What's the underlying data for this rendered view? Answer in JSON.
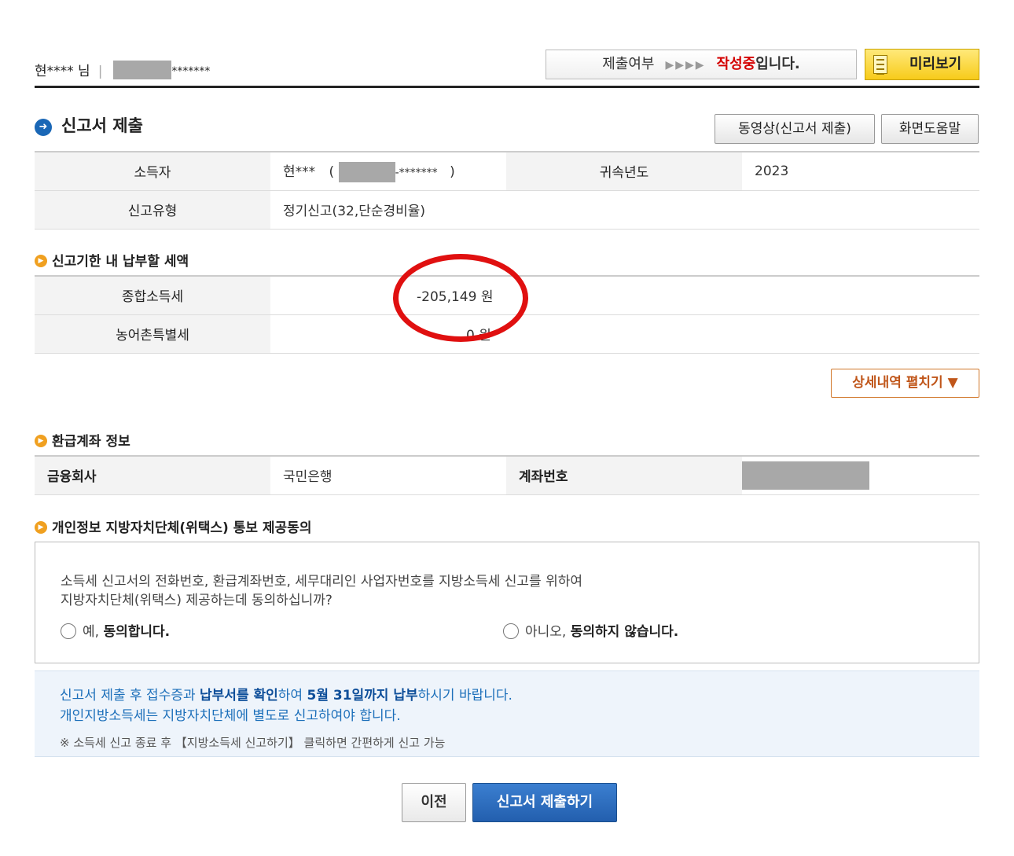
{
  "header": {
    "user_name": "현**** 님",
    "separator": "|",
    "user_id_suffix": "*******",
    "status_label": "제출여부",
    "status_arrows": "▶▶▶▶",
    "status_value": "작성중",
    "status_suffix": "입니다.",
    "preview_label": "미리보기",
    "preview_icon": "document-icon"
  },
  "section_title": "신고서 제출",
  "buttons": {
    "video": "동영상(신고서 제출)",
    "help": "화면도움말",
    "detail": "상세내역 펼치기 ▼",
    "prev": "이전",
    "submit": "신고서 제출하기"
  },
  "info": {
    "taxpayer_label": "소득자",
    "taxpayer_name": "현***",
    "taxpayer_open": "(",
    "taxpayer_id_suffix": "-*******",
    "taxpayer_close": ")",
    "year_label": "귀속년도",
    "year_value": "2023",
    "type_label": "신고유형",
    "type_value": "정기신고(32,단순경비율)"
  },
  "tax_section": {
    "title": "신고기한 내 납부할 세액",
    "rows": [
      {
        "label": "종합소득세",
        "value": "-205,149 원"
      },
      {
        "label": "농어촌특별세",
        "value": "0 원"
      }
    ]
  },
  "refund_section": {
    "title": "환급계좌 정보",
    "bank_label": "금융회사",
    "bank_value": "국민은행",
    "account_label": "계좌번호"
  },
  "consent_section": {
    "title": "개인정보 지방자치단체(위택스) 통보 제공동의",
    "question_line1": "소득세 신고서의 전화번호, 환급계좌번호, 세무대리인 사업자번호를 지방소득세 신고를 위하여",
    "question_line2": "지방자치단체(위택스) 제공하는데 동의하십니까?",
    "yes_prefix": "예,",
    "yes_bold": "동의합니다.",
    "no_prefix": "아니오,",
    "no_bold": "동의하지 않습니다."
  },
  "notice": {
    "line1_a": "신고서 제출 후 접수증과",
    "line1_b": "납부서를 확인",
    "line1_c": "하여",
    "line1_d": "5월 31일까지 납부",
    "line1_e": "하시기 바랍니다.",
    "line2": "개인지방소득세는 지방자치단체에 별도로 신고하여야 합니다.",
    "line3": "※ 소득세 신고 종료 후 【지방소득세 신고하기】 클릭하면 간편하게 신고 가능"
  },
  "colors": {
    "accent_blue": "#235fae",
    "status_red": "#d40000",
    "annotation_red": "#e01010",
    "detail_orange": "#d1772a"
  }
}
